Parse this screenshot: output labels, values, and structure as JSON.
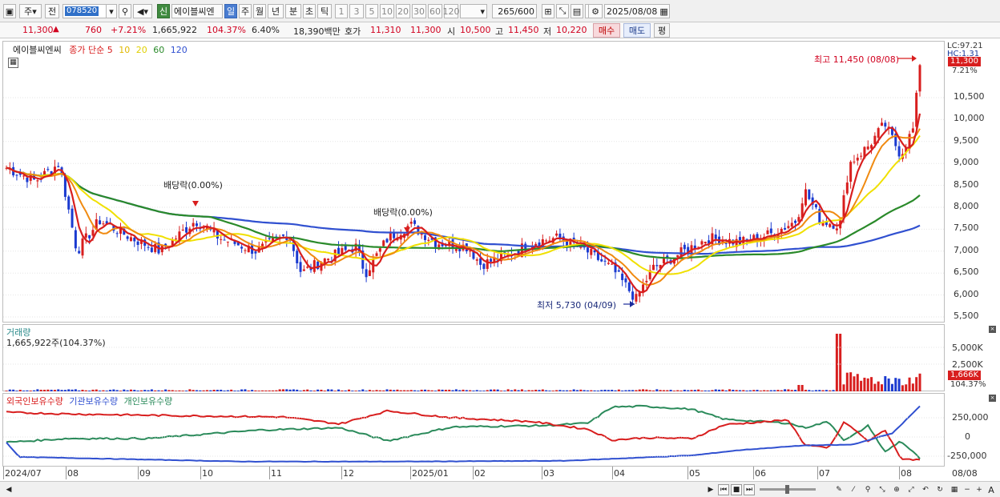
{
  "toolbar": {
    "period_selector": "주",
    "prev_label": "전",
    "stock_code": "078520",
    "stock_name": "에이블씨엔",
    "new_badge": "신",
    "period_tabs": [
      "일",
      "주",
      "월",
      "년",
      "분",
      "초",
      "틱"
    ],
    "interval_buttons": [
      "1",
      "3",
      "5",
      "10",
      "20",
      "30",
      "60",
      "120"
    ],
    "display_count": "265",
    "display_total": "/600",
    "date": "2025/08/08"
  },
  "info": {
    "price": "11,300",
    "change_arrow": "▲",
    "change": "760",
    "change_pct": "+7.21%",
    "volume": "1,665,922",
    "volume_ratio": "104.37%",
    "turnover": "6.40%",
    "amount": "18,390백만",
    "quote_label": "호가",
    "ask": "11,310",
    "bid": "11,300",
    "open_label": "시",
    "open": "10,500",
    "high_label": "고",
    "high": "11,450",
    "low_label": "저",
    "low": "10,220",
    "buy_label": "매수",
    "sell_label": "매도",
    "eval_label": "평"
  },
  "price_panel": {
    "legend_name": "에이블씨엔씨",
    "legend_series": "종가 단순",
    "ma_periods": [
      "5",
      "10",
      "20",
      "60",
      "120"
    ],
    "ma_colors": [
      "#d81e1e",
      "#f08a10",
      "#f0e000",
      "#2a8a2a",
      "#3050d0"
    ],
    "lc_label": "LC:97.21",
    "hc_label": "HC:1.31",
    "price_tag": "11,300",
    "pct_tag": "7.21%",
    "y_ticks": [
      "10,500",
      "10,000",
      "9,500",
      "9,000",
      "8,500",
      "8,000",
      "7,500",
      "7,000",
      "6,500",
      "6,000",
      "5,500"
    ],
    "high_annotation": "최고 11,450 (08/08)",
    "low_annotation": "최저 5,730 (04/09)",
    "dividend_1": "배당락(0.00%)",
    "dividend_2": "배당락(0.00%)"
  },
  "volume_panel": {
    "title": "거래량",
    "value": "1,665,922주(104.37%)",
    "y_ticks": [
      "5,000K",
      "2,500K"
    ],
    "tag": "1,666K",
    "pct_tag": "104.37%"
  },
  "holding_panel": {
    "series": [
      "외국인보유수량",
      "기관보유수량",
      "개인보유수량"
    ],
    "colors": [
      "#d81e1e",
      "#3050d0",
      "#2a8a5a"
    ],
    "y_ticks": [
      "250,000",
      "0",
      "-250,000"
    ]
  },
  "x_axis": [
    "2024/07",
    "08",
    "09",
    "10",
    "11",
    "12",
    "2025/01",
    "02",
    "03",
    "04",
    "05",
    "06",
    "07",
    "08",
    "08/08"
  ]
}
